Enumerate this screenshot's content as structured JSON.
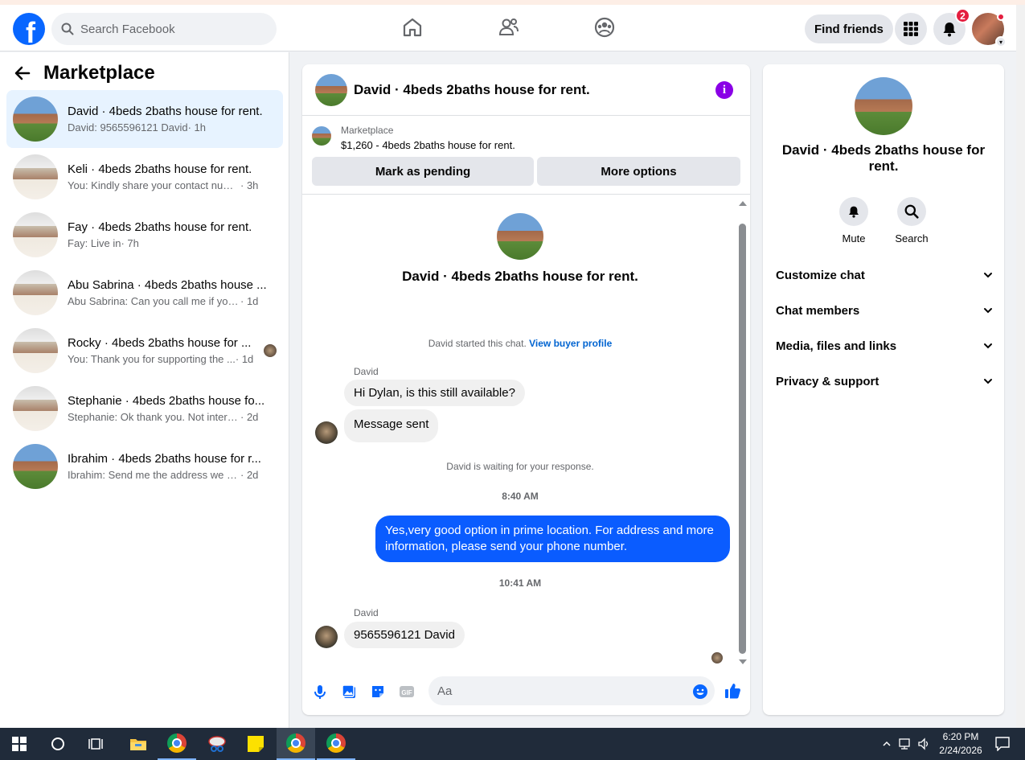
{
  "header": {
    "search_placeholder": "Search Facebook",
    "find_friends_label": "Find friends",
    "notifications_count": "2"
  },
  "sidebar": {
    "title": "Marketplace",
    "conversations": [
      {
        "title": "David · 4beds 2baths house for rent.",
        "snippet": "David: 9565596121 David",
        "time": " · 1h",
        "thumb": "house",
        "active": true
      },
      {
        "title": "Keli · 4beds 2baths house for rent.",
        "snippet": "You: Kindly share your contact numbe...",
        "time": " · 3h",
        "thumb": "snowy"
      },
      {
        "title": "Fay · 4beds 2baths house for rent.",
        "snippet": "Fay: Live in",
        "time": " · 7h",
        "thumb": "snowy"
      },
      {
        "title": "Abu Sabrina · 4beds 2baths house ...",
        "snippet": "Abu Sabrina: Can you call me if you h...",
        "time": " · 1d",
        "thumb": "snowy"
      },
      {
        "title": "Rocky · 4beds 2baths house for ...",
        "snippet": "You: Thank you for supporting the ...",
        "time": " · 1d",
        "thumb": "snowy",
        "seen": true
      },
      {
        "title": "Stephanie · 4beds 2baths house fo...",
        "snippet": "Stephanie: Ok thank you. Not interest...",
        "time": " · 2d",
        "thumb": "snowy"
      },
      {
        "title": "Ibrahim · 4beds 2baths house for r...",
        "snippet": "Ibrahim: Send me the address we will ...",
        "time": " · 2d",
        "thumb": "house"
      }
    ]
  },
  "chat": {
    "header_title": "David · 4beds 2baths house for rent.",
    "listing_label": "Marketplace",
    "listing_detail": "$1,260 - 4beds 2baths house for rent.",
    "mark_pending_label": "Mark as pending",
    "more_options_label": "More options",
    "intro_name": "David · 4beds 2baths house for rent.",
    "started_text": "David started this chat. ",
    "buyer_profile_link": "View buyer profile",
    "messages": {
      "sender_1": "David",
      "msg_1": "Hi Dylan, is this still available?",
      "msg_2": "Message sent",
      "waiting_text": "David is waiting for your response.",
      "time_1": "8:40 AM",
      "msg_out": "Yes,very good option in prime location. For address and more information, please send your phone number.",
      "time_2": "10:41 AM",
      "sender_2": "David",
      "msg_3": "9565596121 David"
    },
    "composer_placeholder": "Aa"
  },
  "info_panel": {
    "name": "David · 4beds 2baths house for rent.",
    "mute_label": "Mute",
    "search_label": "Search",
    "sections": [
      "Customize chat",
      "Chat members",
      "Media, files and links",
      "Privacy & support"
    ]
  },
  "taskbar": {
    "time": "6:20 PM",
    "date": "2/24/2026"
  },
  "colors": {
    "brand": "#0866ff",
    "outgoing_bubble": "#0a5cff",
    "info_icon": "#8a00e6",
    "link": "#0064d1"
  }
}
